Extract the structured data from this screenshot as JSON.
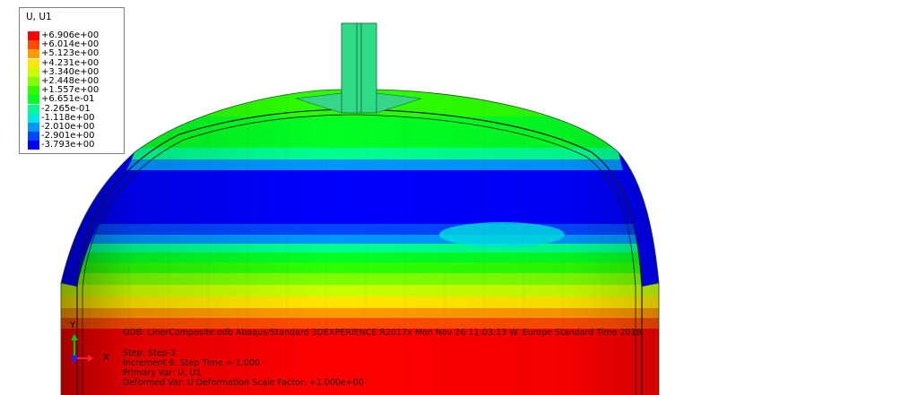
{
  "legend": {
    "title": "U, U1",
    "entries": [
      {
        "label": "+6.906e+00",
        "color": "#ff0000"
      },
      {
        "label": "+6.014e+00",
        "color": "#ff4c00"
      },
      {
        "label": "+5.123e+00",
        "color": "#ff9a00"
      },
      {
        "label": "+4.231e+00",
        "color": "#ffe600"
      },
      {
        "label": "+3.340e+00",
        "color": "#c8ff00"
      },
      {
        "label": "+2.448e+00",
        "color": "#7dff00"
      },
      {
        "label": "+1.557e+00",
        "color": "#2cff00"
      },
      {
        "label": "+6.651e-01",
        "color": "#00ff23"
      },
      {
        "label": "-2.265e-01",
        "color": "#00ff8f"
      },
      {
        "label": "-1.118e+00",
        "color": "#00e6e6"
      },
      {
        "label": "-2.010e+00",
        "color": "#0096ff"
      },
      {
        "label": "-2.901e+00",
        "color": "#0046ff"
      },
      {
        "label": "-3.793e+00",
        "color": "#0000ff"
      }
    ]
  },
  "info": {
    "odb_line": "ODB: LinerComposite.odb    Abaqus/Standard 3DEXPERIENCE R2017x    Mon Nov 26 11:03:13 W. Europe Standard Time 2018",
    "step_line": "Step: Step-3",
    "increment_line": "Increment      6: Step Time =    1.000",
    "primary_var_line": "Primary Var: U, U1",
    "deformed_var_line": "Deformed Var: U   Deformation Scale Factor: +1.000e+00"
  },
  "triad": {
    "y_label": "Y",
    "x_label": "X"
  },
  "bands": [
    {
      "value": -3.793,
      "color": "#0000ff"
    },
    {
      "value": -2.901,
      "color": "#0046ff"
    },
    {
      "value": -2.01,
      "color": "#0096ff"
    },
    {
      "value": -1.118,
      "color": "#00e6e6"
    },
    {
      "value": -0.2265,
      "color": "#00ff8f"
    },
    {
      "value": 0.6651,
      "color": "#00ff23"
    },
    {
      "value": 1.557,
      "color": "#2cff00"
    },
    {
      "value": 2.448,
      "color": "#7dff00"
    },
    {
      "value": 3.34,
      "color": "#c8ff00"
    },
    {
      "value": 4.231,
      "color": "#ffe600"
    },
    {
      "value": 5.123,
      "color": "#ff9a00"
    },
    {
      "value": 6.014,
      "color": "#ff4c00"
    },
    {
      "value": 6.906,
      "color": "#ff0000"
    }
  ]
}
